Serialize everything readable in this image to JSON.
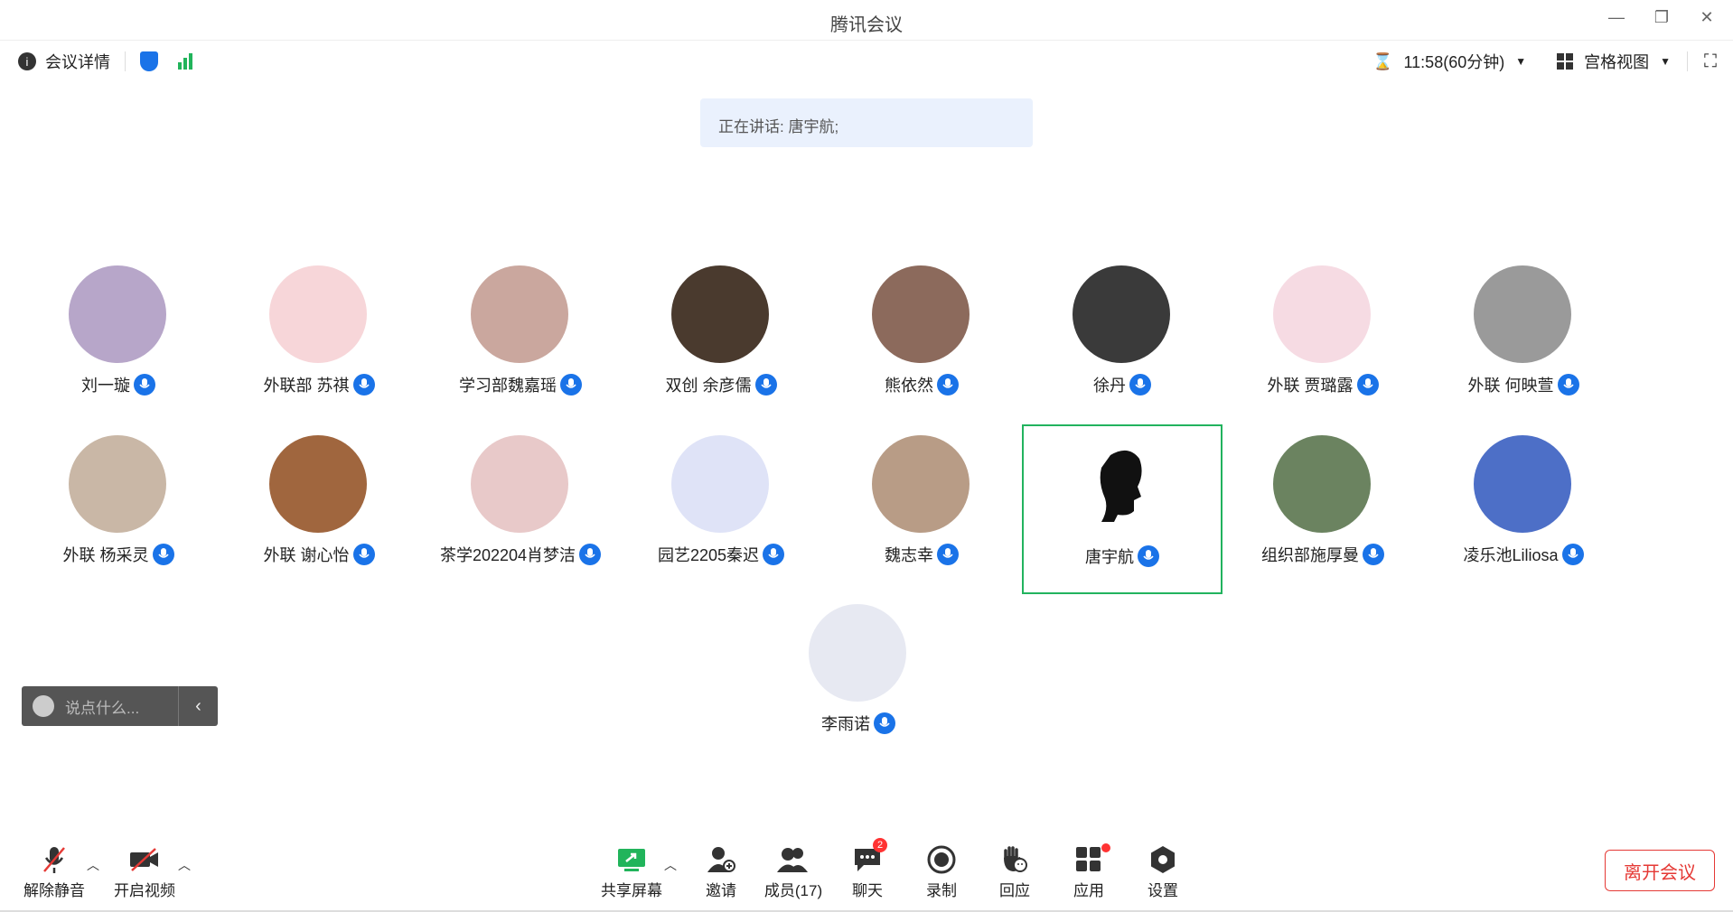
{
  "window": {
    "title": "腾讯会议"
  },
  "infobar": {
    "details_label": "会议详情",
    "timer": "11:58(60分钟)",
    "view_label": "宫格视图"
  },
  "speaking": "正在讲话: 唐宇航;",
  "participants": [
    {
      "name": "刘一璇",
      "color": "#b7a6c9"
    },
    {
      "name": "外联部 苏祺",
      "color": "#f7d6d9"
    },
    {
      "name": "学习部魏嘉瑶",
      "color": "#caa79e"
    },
    {
      "name": "双创 余彦儒",
      "color": "#4a3a2e"
    },
    {
      "name": "熊依然",
      "color": "#8c6a5c"
    },
    {
      "name": "徐丹",
      "color": "#3a3a3a"
    },
    {
      "name": "外联 贾璐露",
      "color": "#f6dbe3"
    },
    {
      "name": "外联 何映萱",
      "color": "#9a9a9a"
    },
    {
      "name": "外联 杨采灵",
      "color": "#c9b7a6"
    },
    {
      "name": "外联 谢心怡",
      "color": "#a0663e"
    },
    {
      "name": "茶学202204肖梦洁",
      "color": "#e8c9c9"
    },
    {
      "name": "园艺2205秦迟",
      "color": "#dfe3f7"
    },
    {
      "name": "魏志幸",
      "color": "#b89c86"
    },
    {
      "name": "唐宇航",
      "color": "#ffffff"
    },
    {
      "name": "组织部施厚曼",
      "color": "#6b8360"
    },
    {
      "name": "凌乐池Liliosa",
      "color": "#4d6fc7"
    },
    {
      "name": "李雨诺",
      "color": "#e7e9f2"
    }
  ],
  "chat": {
    "placeholder": "说点什么..."
  },
  "toolbar": {
    "unmute": "解除静音",
    "video": "开启视频",
    "share": "共享屏幕",
    "invite": "邀请",
    "members": "成员(17)",
    "chat": "聊天",
    "chat_badge": "2",
    "record": "录制",
    "react": "回应",
    "apps": "应用",
    "settings": "设置",
    "leave": "离开会议"
  }
}
